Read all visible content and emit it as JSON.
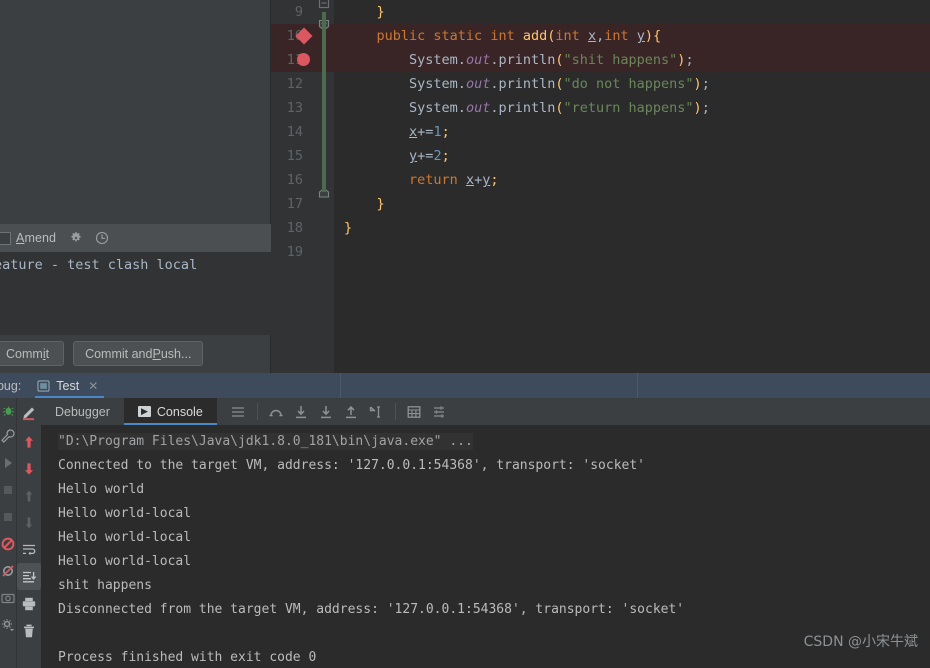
{
  "commit_dialog": {
    "amend_checkbox_label": "Amend",
    "amend_checkbox_checked": false,
    "gear_icon": "gear-icon",
    "history_icon": "clock-icon",
    "message_text": "eature - test clash local",
    "commit_button": "Commit",
    "commit_push_button": "Commit and Push..."
  },
  "editor": {
    "first_visible_line": 9,
    "lines": [
      {
        "num": 9,
        "text": "    }",
        "marker": "none",
        "highlight": false
      },
      {
        "num": 10,
        "text": "    public static int add(int x,int y){",
        "marker": "execution-point",
        "highlight": true
      },
      {
        "num": 11,
        "text": "        System.out.println(\"shit happens\");",
        "marker": "breakpoint",
        "highlight": true
      },
      {
        "num": 12,
        "text": "        System.out.println(\"do not happens\");",
        "marker": "none",
        "highlight": false
      },
      {
        "num": 13,
        "text": "        System.out.println(\"return happens\");",
        "marker": "none",
        "highlight": false
      },
      {
        "num": 14,
        "text": "        x+=1;",
        "marker": "none",
        "highlight": false
      },
      {
        "num": 15,
        "text": "        y+=2;",
        "marker": "none",
        "highlight": false
      },
      {
        "num": 16,
        "text": "        return x+y;",
        "marker": "none",
        "highlight": false
      },
      {
        "num": 17,
        "text": "    }",
        "marker": "none",
        "highlight": false
      },
      {
        "num": 18,
        "text": "}",
        "marker": "none",
        "highlight": false
      },
      {
        "num": 19,
        "text": "",
        "marker": "none",
        "highlight": false
      }
    ],
    "colors": {
      "background": "#2b2b2b",
      "gutter_background": "#313335",
      "highlight_line": "#3a2526",
      "keyword": "#cc7832",
      "method_name": "#ffc66d",
      "string": "#6a8759",
      "number": "#6897bb",
      "field_static": "#9876aa",
      "default_text": "#a9b7c6",
      "line_number": "#606366",
      "breakpoint": "#db5860",
      "method_bracket": "#4e6a4e"
    }
  },
  "debug_window": {
    "title": "ebug:",
    "session_tab": {
      "label": "Test",
      "icon": "run-configuration-icon",
      "close_icon": "close-icon",
      "active": true
    },
    "tabs": [
      {
        "label": "Debugger",
        "active": false
      },
      {
        "label": "Console",
        "active": true,
        "icon": "console-icon"
      }
    ],
    "toolbar_icons": [
      "menu-lines-icon",
      "step-over-icon",
      "step-into-icon",
      "force-step-into-icon",
      "step-out-icon",
      "run-to-cursor-icon",
      "evaluate-expression-icon",
      "settings-lines-icon"
    ],
    "side_rail_icons": [
      "rerun-icon",
      "up-arrow-red-icon",
      "down-arrow-red-icon",
      "up-arrow-gray-icon",
      "down-arrow-gray-icon",
      "soft-wrap-icon",
      "scroll-to-end-icon",
      "print-icon",
      "trash-icon"
    ],
    "selected_rail_icon": "scroll-to-end-icon"
  },
  "console_output": [
    {
      "text": "\"D:\\Program Files\\Java\\jdk1.8.0_181\\bin\\java.exe\" ...",
      "type": "system"
    },
    {
      "text": "Connected to the target VM, address: '127.0.0.1:54368', transport: 'socket'",
      "type": "normal"
    },
    {
      "text": "Hello world",
      "type": "normal"
    },
    {
      "text": "Hello world-local",
      "type": "normal"
    },
    {
      "text": "Hello world-local",
      "type": "normal"
    },
    {
      "text": "Hello world-local",
      "type": "normal"
    },
    {
      "text": "shit happens",
      "type": "normal"
    },
    {
      "text": "Disconnected from the target VM, address: '127.0.0.1:54368', transport: 'socket'",
      "type": "normal"
    },
    {
      "text": "",
      "type": "normal"
    },
    {
      "text": "Process finished with exit code 0",
      "type": "normal"
    }
  ],
  "watermark": "CSDN @小宋牛斌"
}
